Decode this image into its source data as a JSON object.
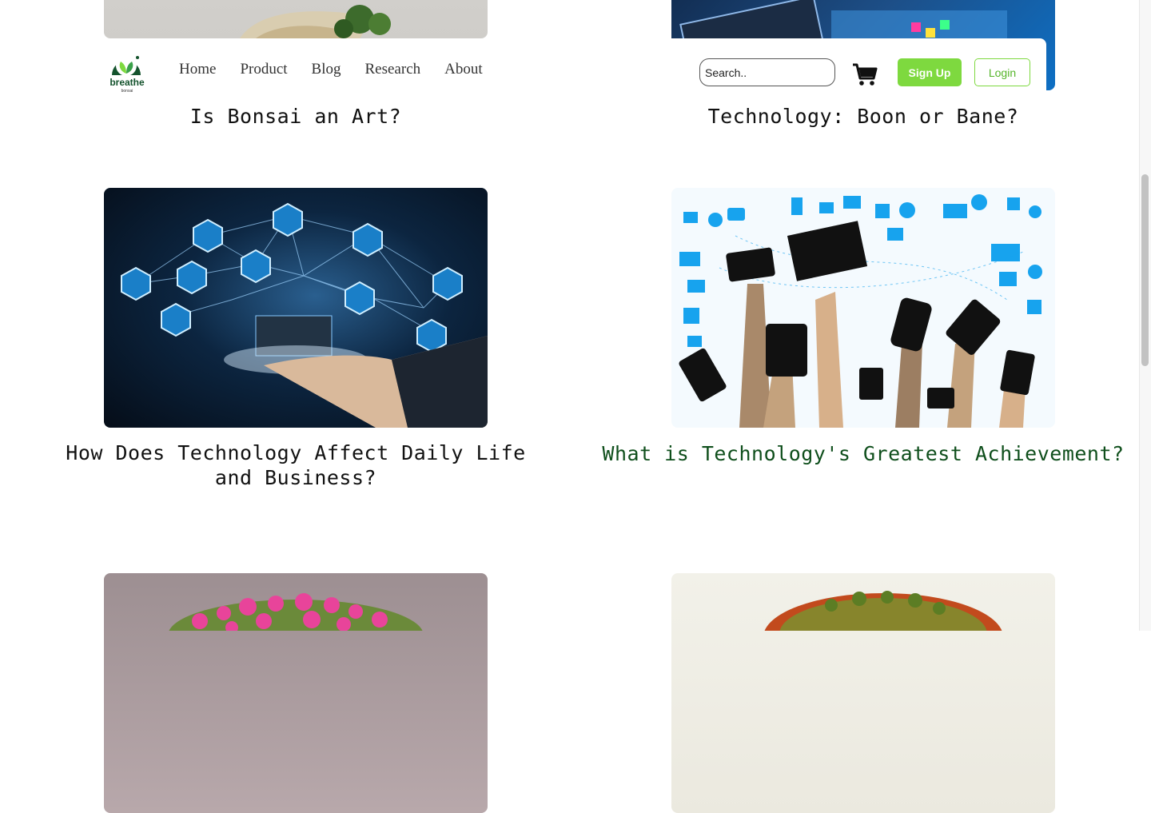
{
  "header": {
    "logo_text": "breathe",
    "logo_subtext": "bonsai",
    "nav": [
      "Home",
      "Product",
      "Blog",
      "Research",
      "About"
    ],
    "search_placeholder": "Search..",
    "signup_label": "Sign Up",
    "login_label": "Login"
  },
  "posts": [
    {
      "title": "Is Bonsai an Art?"
    },
    {
      "title": "Technology: Boon or Bane?"
    },
    {
      "title": "How Does Technology Affect Daily Life and Business?"
    },
    {
      "title": "What is Technology's Greatest Achievement?"
    }
  ],
  "colors": {
    "accent_green": "#7ed93f",
    "active_title": "#0f4f1c",
    "logo_green": "#14532d"
  }
}
